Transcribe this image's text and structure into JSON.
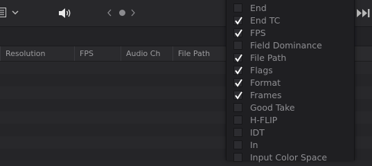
{
  "toolbar": {
    "view_icon": "grid-view-icon",
    "dropdown_icon": "chevron-down-icon",
    "audio_icon": "speaker-icon",
    "prev_icon": "chevron-left-icon",
    "next_icon": "chevron-right-icon",
    "skip_icon": "skip-to-end-icon"
  },
  "columns": [
    "Resolution",
    "FPS",
    "Audio Ch",
    "File Path"
  ],
  "column_menu": {
    "items": [
      {
        "label": "End",
        "checked": false
      },
      {
        "label": "End TC",
        "checked": true
      },
      {
        "label": "FPS",
        "checked": true
      },
      {
        "label": "Field Dominance",
        "checked": false
      },
      {
        "label": "File Path",
        "checked": true
      },
      {
        "label": "Flags",
        "checked": true
      },
      {
        "label": "Format",
        "checked": true
      },
      {
        "label": "Frames",
        "checked": true
      },
      {
        "label": "Good Take",
        "checked": false
      },
      {
        "label": "H-FLIP",
        "checked": false
      },
      {
        "label": "IDT",
        "checked": false
      },
      {
        "label": "In",
        "checked": false
      },
      {
        "label": "Input Color Space",
        "checked": false
      }
    ]
  },
  "colors": {
    "background": "#262629",
    "menu_background": "#1f1f22",
    "text": "#8e8e92",
    "check": "#ffffff"
  }
}
